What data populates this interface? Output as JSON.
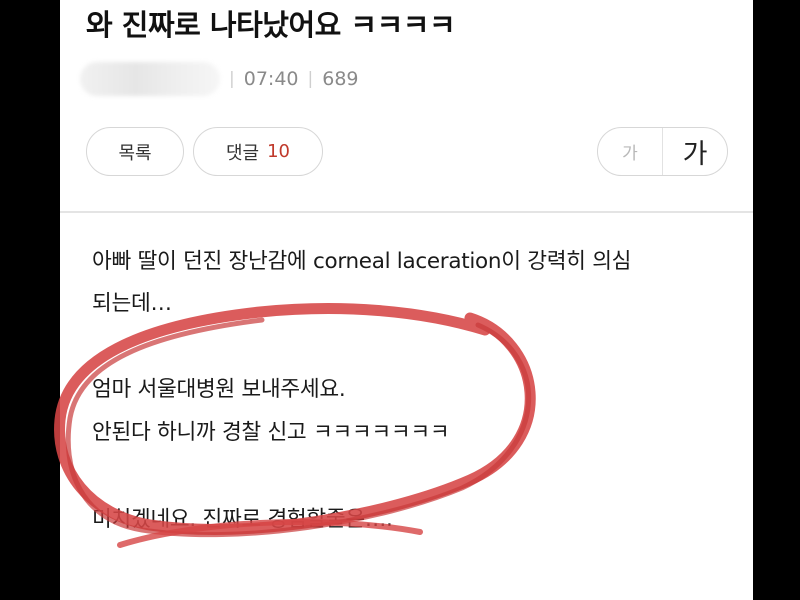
{
  "post": {
    "title": "와 진짜로 나타났어요 ㅋㅋㅋㅋ",
    "time": "07:40",
    "views": "689"
  },
  "toolbar": {
    "list_label": "목록",
    "comments_label": "댓글",
    "comments_count": "10",
    "font_small": "가",
    "font_large": "가"
  },
  "content": {
    "lines": [
      "아빠 딸이 던진 장난감에 corneal laceration이 강력히 의심",
      "되는데…",
      "엄마 서울대병원 보내주세요.",
      "안된다 하니까 경찰 신고 ㅋㅋㅋㅋㅋㅋㅋ",
      "미치겠네요. 진짜로 경험할줄은…."
    ]
  },
  "colors": {
    "accent": "#c0392b",
    "annotation_circle": "#d64545"
  }
}
